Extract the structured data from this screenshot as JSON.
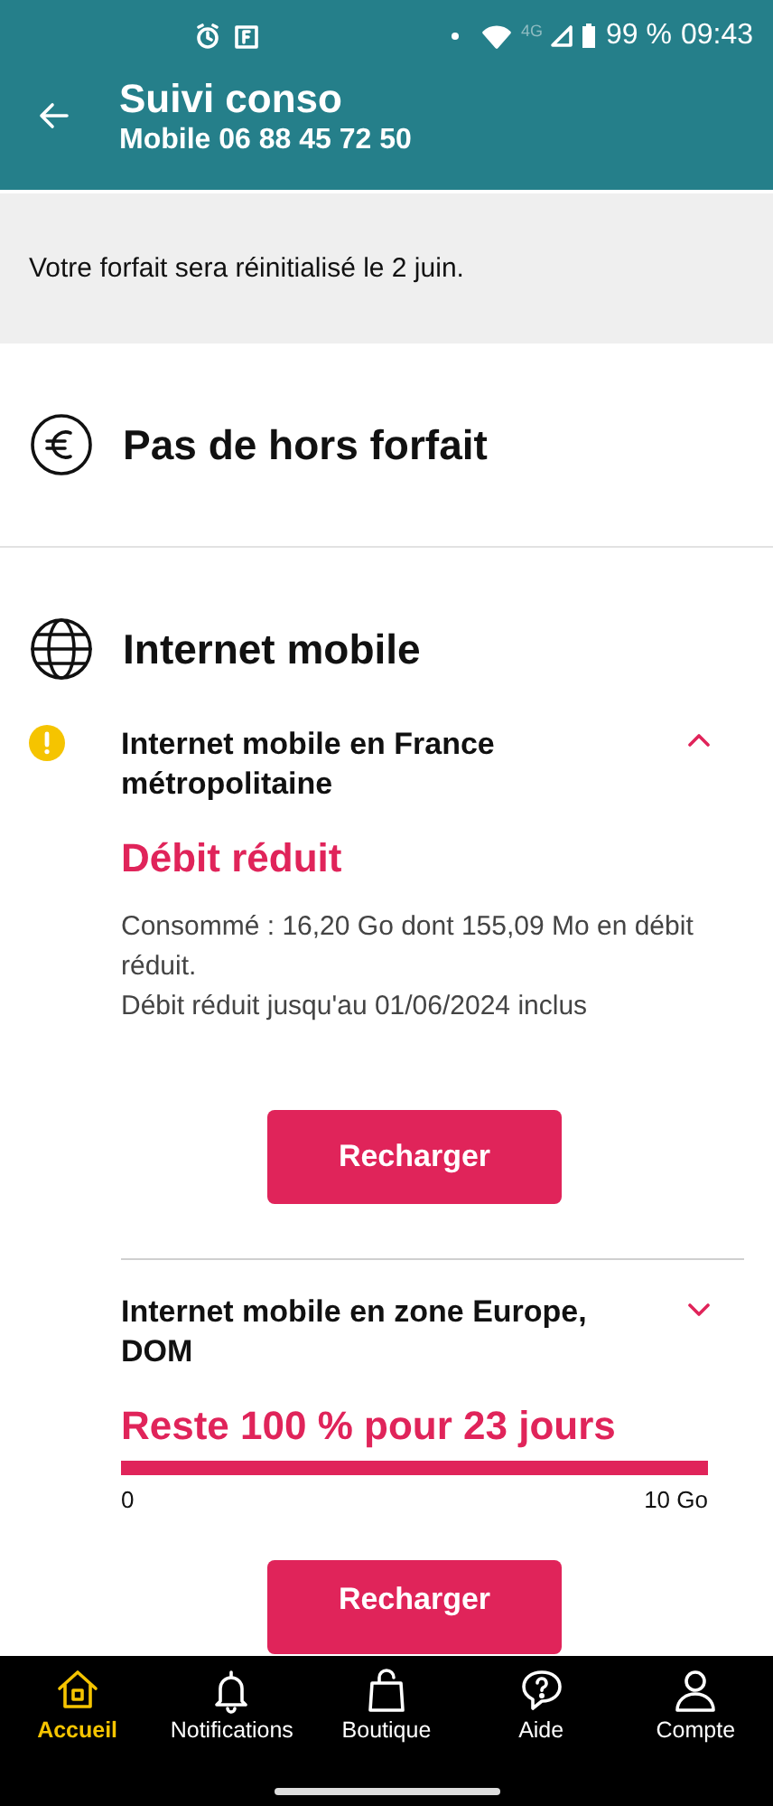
{
  "status_bar": {
    "time": "09:43",
    "battery": "99 %",
    "network": "4G"
  },
  "header": {
    "title": "Suivi conso",
    "subtitle": "Mobile 06 88 45 72 50"
  },
  "notice": "Votre forfait sera réinitialisé le 2 juin.",
  "overage": {
    "title": "Pas de hors forfait"
  },
  "internet": {
    "title": "Internet mobile",
    "items": [
      {
        "kind": "reduced",
        "title": "Internet mobile en France métropolitaine",
        "warning": true,
        "expanded": true,
        "status": "Débit réduit",
        "details": [
          "Consommé : 16,20 Go dont 155,09 Mo en débit réduit.",
          "Débit réduit jusqu'au 01/06/2024 inclus"
        ],
        "button": "Recharger"
      },
      {
        "kind": "gauge",
        "title": "Internet mobile en zone Europe, DOM",
        "warning": false,
        "expanded": false,
        "status": "Reste 100 % pour 23 jours",
        "level": 1,
        "min": "0",
        "max": "10 Go",
        "button": "Recharger"
      }
    ]
  },
  "nav": [
    {
      "label": "Accueil",
      "kind": "home",
      "selected": true
    },
    {
      "label": "Notifications",
      "kind": "bell",
      "selected": false
    },
    {
      "label": "Boutique",
      "kind": "bag",
      "selected": false
    },
    {
      "label": "Aide",
      "kind": "help",
      "selected": false
    },
    {
      "label": "Compte",
      "kind": "user",
      "selected": false
    }
  ]
}
